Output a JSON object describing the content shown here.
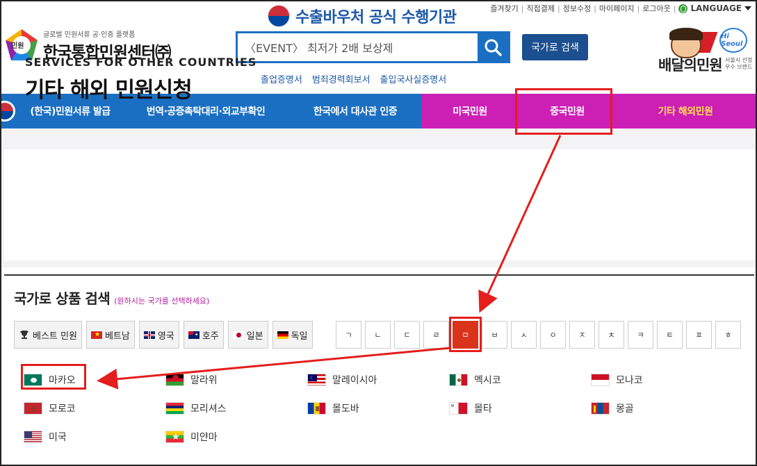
{
  "header": {
    "top_links": [
      "즐겨찾기",
      "직접결제",
      "정보수정",
      "마이페이지",
      "로그아웃"
    ],
    "language_label": "LANGUAGE",
    "voucher_text": "수출바우처 공식 수행기관",
    "logo_sub": "글로벌 민원서류 공·인증 플랫폼",
    "logo_main": "한국통합민원센터㈜",
    "logo_badge": "민원",
    "search_value": "〈EVENT〉 최저가 2배 보상제",
    "country_search_button": "국가로 검색",
    "quick_links": [
      "졸업증명서",
      "범죄경력회보서",
      "출입국사실증명서"
    ],
    "partner_name": "배달의민원",
    "partner_hi": "Hi Seoul",
    "partner_note": "서울시 선정 우수 브랜드"
  },
  "nav": {
    "items": [
      {
        "label": "(한국)민원서류 발급"
      },
      {
        "label": "번역·공증촉탁대리·외교부확인"
      },
      {
        "label": "한국에서 대사관 인증"
      },
      {
        "label": "미국민원"
      },
      {
        "label": "중국민원"
      },
      {
        "label": "기타 해외민원"
      }
    ]
  },
  "hero": {
    "en": "SERVICES FOR OTHER COUNTRIES",
    "ko": "기타 해외 민원신청"
  },
  "country_search": {
    "title": "국가로 상품 검색",
    "subtitle": "(원하시는 국가를 선택하세요)",
    "quick_buttons": [
      {
        "label": "베스트 민원",
        "icon": "trophy-icon"
      },
      {
        "label": "베트남",
        "icon": "vietnam-flag-icon"
      },
      {
        "label": "영국",
        "icon": "uk-flag-icon"
      },
      {
        "label": "호주",
        "icon": "australia-flag-icon"
      },
      {
        "label": "일본",
        "icon": "japan-flag-icon"
      },
      {
        "label": "독일",
        "icon": "germany-flag-icon"
      }
    ],
    "consonants": [
      "ㄱ",
      "ㄴ",
      "ㄷ",
      "ㄹ",
      "ㅁ",
      "ㅂ",
      "ㅅ",
      "ㅇ",
      "ㅈ",
      "ㅊ",
      "ㅋ",
      "ㅌ",
      "ㅍ",
      "ㅎ"
    ],
    "active_consonant": "ㅁ",
    "countries": [
      [
        {
          "name": "마카오",
          "flag": "macau"
        },
        {
          "name": "말라위",
          "flag": "malawi"
        },
        {
          "name": "말레이시아",
          "flag": "malaysia"
        },
        {
          "name": "멕시코",
          "flag": "mexico"
        },
        {
          "name": "모나코",
          "flag": "monaco"
        }
      ],
      [
        {
          "name": "모로코",
          "flag": "morocco"
        },
        {
          "name": "모리셔스",
          "flag": "mauritius"
        },
        {
          "name": "몰도바",
          "flag": "moldova"
        },
        {
          "name": "몰타",
          "flag": "malta"
        },
        {
          "name": "몽골",
          "flag": "mongolia"
        }
      ],
      [
        {
          "name": "미국",
          "flag": "usa"
        },
        {
          "name": "미얀마",
          "flag": "myanmar"
        }
      ]
    ]
  },
  "colors": {
    "nav_blue": "#1b6fc2",
    "nav_pink": "#cc1fb4",
    "active_consonant": "#d9341b",
    "annotation_red": "#e41d1d"
  }
}
